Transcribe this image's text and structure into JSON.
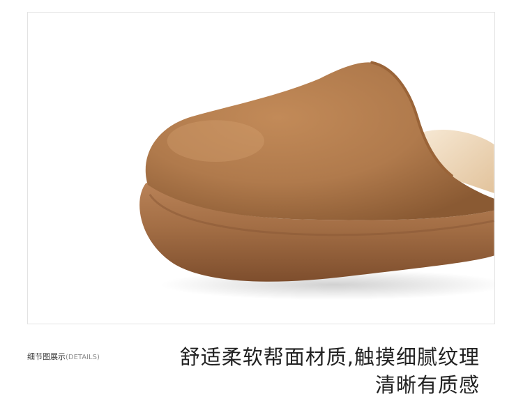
{
  "detail_section": {
    "label_cn": "细节图展示",
    "label_en": "(DETAILS)"
  },
  "headline": {
    "line1": "舒适柔软帮面材质,触摸细腻纹理",
    "line2": "清晰有质感"
  },
  "product_image": {
    "subject": "tan suede slipper toe with plush lining and thick rounded sole",
    "colors": {
      "suede": "#b07a4c",
      "suede_shadow": "#8a5a33",
      "sole": "#a36e45",
      "sole_dark": "#7a4a2a",
      "lining": "#f1ddc3"
    }
  }
}
